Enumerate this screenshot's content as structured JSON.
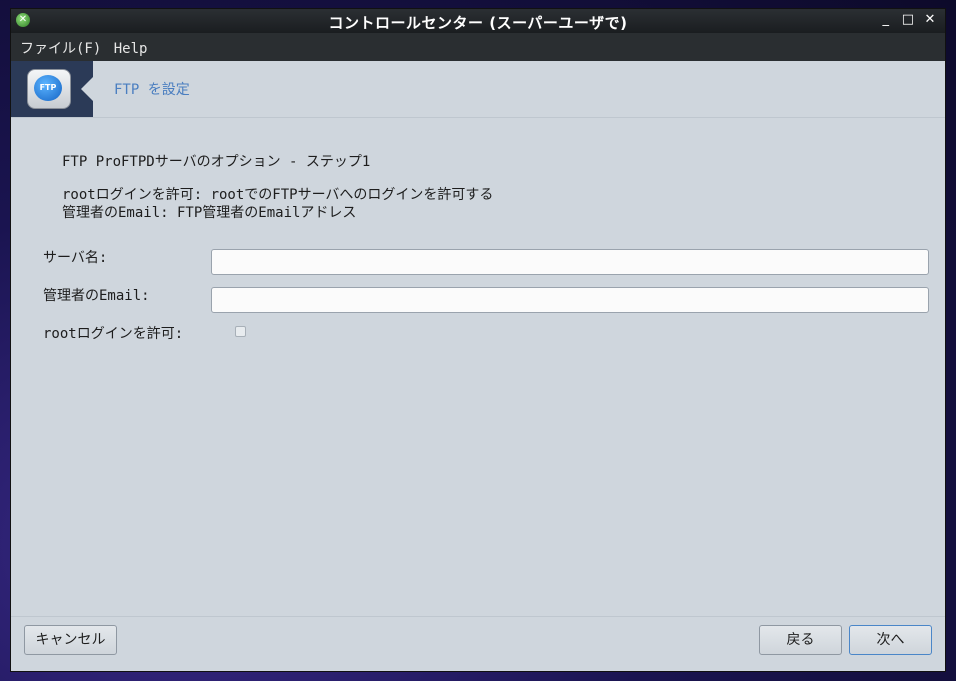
{
  "window": {
    "title": "コントロールセンター (スーパーユーザで)"
  },
  "window_controls": {
    "minimize": "_",
    "maximize": "□",
    "close": "✕"
  },
  "menu": {
    "file": "ファイル(F)",
    "help": "Help"
  },
  "banner": {
    "title": "FTP を設定",
    "icon_text": "FTP"
  },
  "content": {
    "heading": "FTP ProFTPDサーバのオプション - ステップ1",
    "description_line1": "rootログインを許可: rootでのFTPサーバへのログインを許可する",
    "description_line2": "管理者のEmail: FTP管理者のEmailアドレス"
  },
  "form": {
    "server_name_label": "サーバ名:",
    "server_name_value": "",
    "admin_email_label": "管理者のEmail:",
    "admin_email_value": "",
    "allow_root_label": "rootログインを許可:",
    "allow_root_checked": false
  },
  "buttons": {
    "cancel": "キャンセル",
    "back": "戻る",
    "next": "次へ"
  }
}
